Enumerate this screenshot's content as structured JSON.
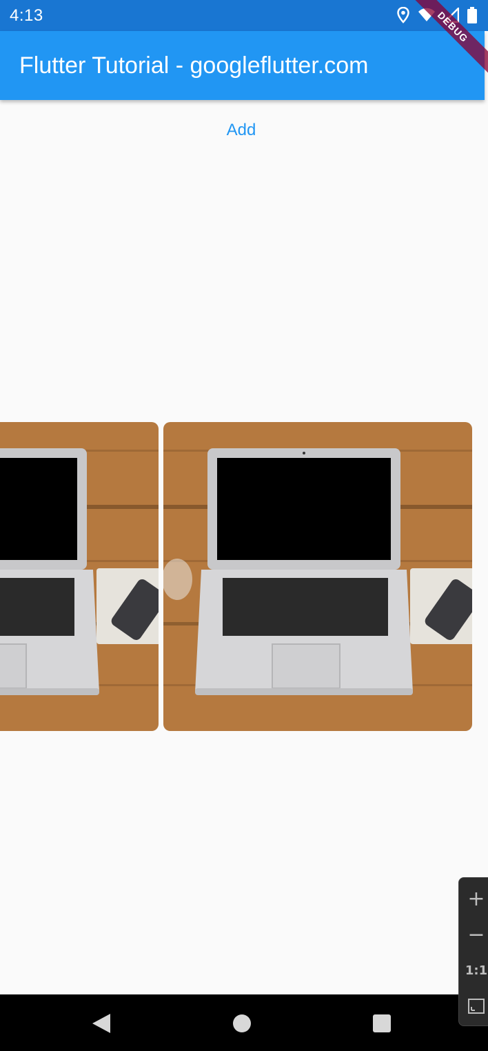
{
  "status_bar": {
    "time": "4:13",
    "icons": [
      "location-icon",
      "wifi-icon",
      "signal-icon",
      "battery-icon"
    ]
  },
  "app_bar": {
    "title": "Flutter Tutorial - googleflutter.com",
    "color": "#2196f3"
  },
  "debug_banner": {
    "label": "DEBUG"
  },
  "main": {
    "add_label": "Add"
  },
  "carousel": {
    "items": [
      {
        "image": "laptop-on-desk-photo"
      },
      {
        "image": "laptop-on-desk-photo"
      }
    ]
  },
  "zoom_controls": {
    "zoom_in": "+",
    "zoom_out": "−",
    "ratio": "1:1"
  },
  "nav_bar": {
    "buttons": [
      "back-icon",
      "home-icon",
      "recents-icon"
    ]
  },
  "colors": {
    "status_bar": "#1976d2",
    "accent": "#2196f3",
    "background": "#fafafa"
  }
}
